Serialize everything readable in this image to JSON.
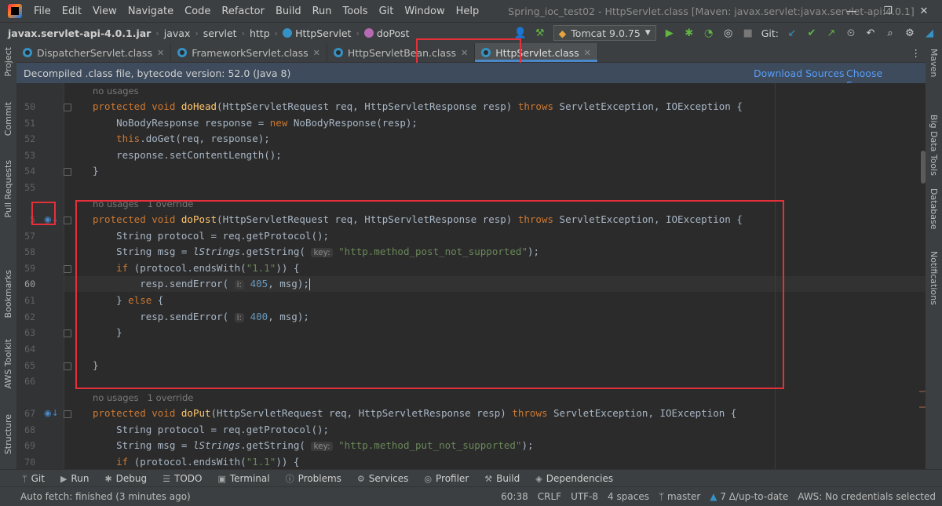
{
  "window": {
    "title": "Spring_ioc_test02 - HttpServlet.class [Maven: javax.servlet:javax.servlet-api:4.0.1]",
    "menu": [
      "File",
      "Edit",
      "View",
      "Navigate",
      "Code",
      "Refactor",
      "Build",
      "Run",
      "Tools",
      "Git",
      "Window",
      "Help"
    ]
  },
  "breadcrumb": {
    "jar": "javax.servlet-api-4.0.1.jar",
    "parts": [
      "javax",
      "servlet",
      "http"
    ],
    "class": "HttpServlet",
    "method": "doPost"
  },
  "toolbar": {
    "run_config": "Tomcat 9.0.75",
    "git_label": "Git:"
  },
  "tabs": [
    {
      "label": "DispatcherServlet.class",
      "active": false
    },
    {
      "label": "FrameworkServlet.class",
      "active": false
    },
    {
      "label": "HttpServletBean.class",
      "active": false
    },
    {
      "label": "HttpServlet.class",
      "active": true
    }
  ],
  "banner": {
    "text": "Decompiled .class file, bytecode version: 52.0 (Java 8)",
    "download": "Download Sources",
    "choose": "Choose Sources..."
  },
  "editor": {
    "hints": {
      "usages1": "no usages",
      "usages2": "no usages   1 override",
      "usages3": "no usages   1 override"
    },
    "line_numbers": [
      "50",
      "51",
      "52",
      "53",
      "54",
      "55",
      "5",
      "57",
      "58",
      "59",
      "60",
      "61",
      "62",
      "63",
      "64",
      "65",
      "66",
      "67",
      "68",
      "69",
      "70"
    ],
    "param_key": "key:",
    "param_i": "i:"
  },
  "left_tools": [
    "Project",
    "Commit",
    "Pull Requests",
    "Bookmarks",
    "AWS Toolkit",
    "Structure"
  ],
  "right_tools": [
    "Maven",
    "Big Data Tools",
    "Database",
    "Notifications"
  ],
  "tool_windows": [
    "Git",
    "Run",
    "Debug",
    "TODO",
    "Terminal",
    "Problems",
    "Services",
    "Profiler",
    "Build",
    "Dependencies"
  ],
  "status": {
    "message": "Auto fetch: finished (3 minutes ago)",
    "position": "60:38",
    "line_sep": "CRLF",
    "encoding": "UTF-8",
    "indent": "4 spaces",
    "branch": "master",
    "vcs": "7 Δ/up-to-date",
    "aws": "AWS: No credentials selected"
  },
  "colors": {
    "highlight_box": "#e5303a",
    "active_tab_underline": "#4a88c7",
    "keyword": "#cc7832",
    "method": "#ffc66d",
    "string": "#6a8759",
    "number": "#6897bb"
  }
}
